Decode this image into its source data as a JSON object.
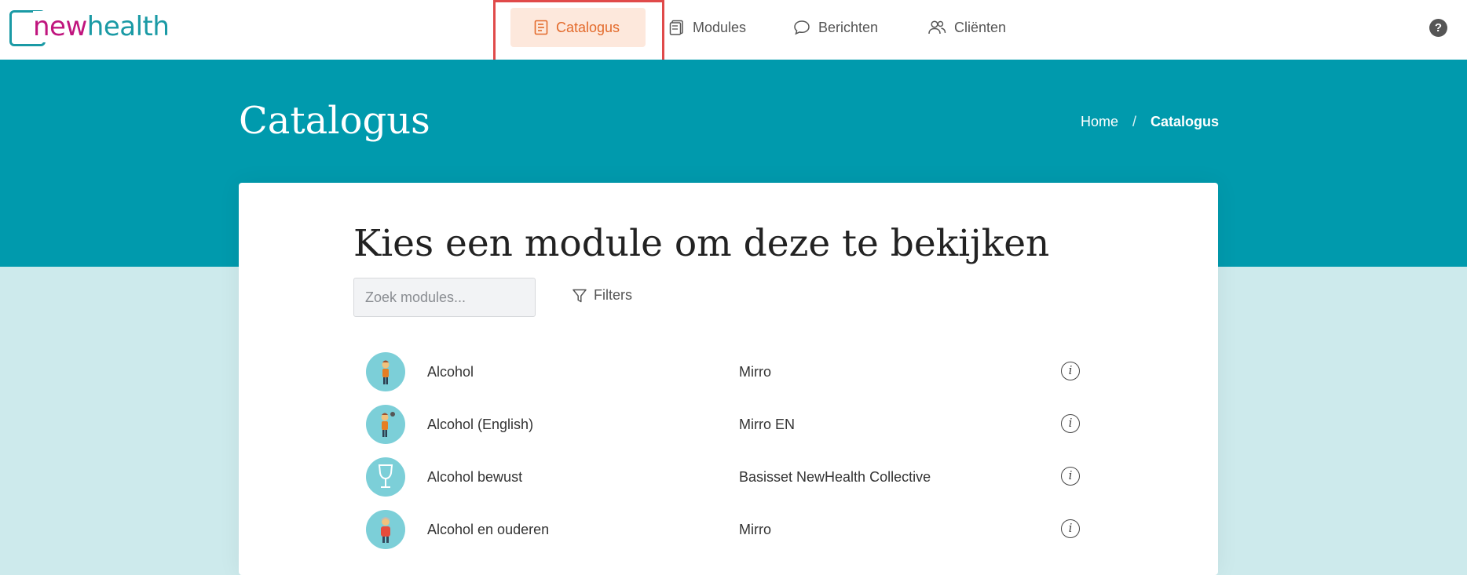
{
  "app": {
    "logo_new": "new",
    "logo_health": "health"
  },
  "nav": [
    {
      "label": "Catalogus",
      "icon": "catalog-icon",
      "active": true
    },
    {
      "label": "Modules",
      "icon": "notebook-icon",
      "active": false
    },
    {
      "label": "Berichten",
      "icon": "chat-bubble-icon",
      "active": false
    },
    {
      "label": "Cliënten",
      "icon": "users-icon",
      "active": false
    }
  ],
  "help_label": "?",
  "hero": {
    "title": "Catalogus",
    "breadcrumb": {
      "home": "Home",
      "separator": "/",
      "current": "Catalogus"
    }
  },
  "main": {
    "heading": "Kies een module om deze te bekijken",
    "search_placeholder": "Zoek modules...",
    "filters_label": "Filters",
    "modules": [
      {
        "name": "Alcohol",
        "collection": "Mirro",
        "info": "i"
      },
      {
        "name": "Alcohol (English)",
        "collection": "Mirro EN",
        "info": "i"
      },
      {
        "name": "Alcohol bewust",
        "collection": "Basisset NewHealth Collective",
        "info": "i"
      },
      {
        "name": "Alcohol en ouderen",
        "collection": "Mirro",
        "info": "i"
      }
    ]
  },
  "colors": {
    "brand_teal": "#009aad",
    "brand_magenta": "#c0157e",
    "active_nav_bg": "#fde8dc",
    "active_nav_text": "#e36a2b",
    "page_bg": "#cdeaec"
  }
}
